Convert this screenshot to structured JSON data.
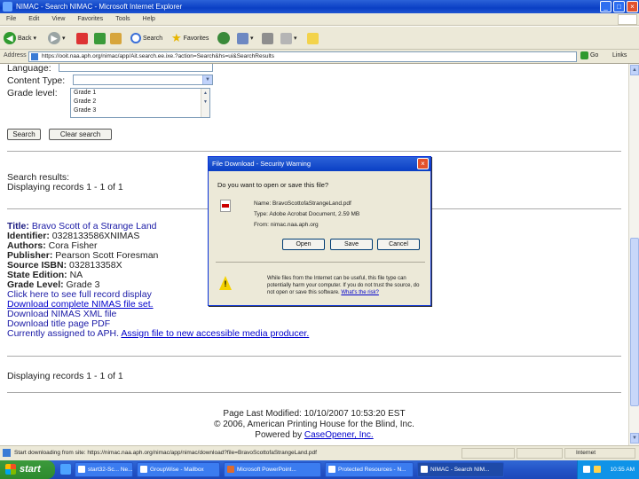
{
  "window": {
    "title": "NIMAC - Search NIMAC - Microsoft Internet Explorer"
  },
  "menu": [
    "File",
    "Edit",
    "View",
    "Favorites",
    "Tools",
    "Help"
  ],
  "toolbar": {
    "back": "Back",
    "search": "Search",
    "favorites": "Favorites"
  },
  "address": {
    "label": "Address",
    "url": "https://ooit.naa.aph.org/nimac/app/Ait.search.ee.ixe.?action=Search&hs=ui&SearchResults",
    "go": "Go",
    "links": "Links"
  },
  "form": {
    "language_label": "Language:",
    "content_type_label": "Content Type:",
    "grade_level_label": "Grade level:",
    "grades": [
      "Grade 1",
      "Grade 2",
      "Grade 3"
    ],
    "search_button": "Search",
    "clear_button": "Clear search"
  },
  "results": {
    "heading": "Search results:",
    "displaying": "Displaying records 1 - 1 of 1",
    "title_label": "Title:",
    "title_value": "Bravo Scott of a Strange Land",
    "identifier_label": "Identifier:",
    "identifier_value": "0328133586XNIMAS",
    "authors_label": "Authors:",
    "authors_value": "Cora Fisher",
    "publisher_label": "Publisher:",
    "publisher_value": "Pearson Scott Foresman",
    "isbn_label": "Source ISBN:",
    "isbn_value": "032813358X",
    "state_label": "State Edition:",
    "state_value": "NA",
    "grade_label": "Grade Level:",
    "grade_value": "Grade 3",
    "link_display": "Click here to see full record display",
    "link_zip": "Download complete NIMAS file set.",
    "link_xml": "Download NIMAS XML file",
    "link_pdf": "Download title page PDF",
    "assigned_text": "Currently assigned to APH.",
    "assigned_link": "Assign file to new accessible media producer.",
    "displaying_bottom": "Displaying records 1 - 1 of 1"
  },
  "footer": {
    "modified": "Page Last Modified: 10/10/2007 10:53:20 EST",
    "copyright": "© 2006, American Printing House for the Blind, Inc.",
    "powered": "Powered by",
    "powered_link": "CaseOpener, Inc."
  },
  "dialog": {
    "title": "File Download - Security Warning",
    "question": "Do you want to open or save this file?",
    "name_row": "Name: BravoScottofaStrangeLand.pdf",
    "type_row": "Type: Adobe Acrobat Document, 2.59 MB",
    "from_row": "From: nimac.naa.aph.org",
    "open": "Open",
    "save": "Save",
    "cancel": "Cancel",
    "warning": "While files from the Internet can be useful, this file type can potentially harm your computer. If you do not trust the source, do not open or save this software.",
    "warning_link": "What's the risk?"
  },
  "status": {
    "text": "Start downloading from site: https://nimac.naa.aph.org/nimac/app/nimac/download?file=BravoScottofaStrangeLand.pdf",
    "zone": "Internet"
  },
  "taskbar": {
    "start": "start",
    "tasks": [
      "start32-Sc... Ne...",
      "GroupWise - Mailbox",
      "Microsoft PowerPoint...",
      "Protected Resources - N...",
      "NIMAC - Search NIM..."
    ],
    "clock": "10:55 AM"
  },
  "colors": {
    "title_blue": "#0a3fc4",
    "result_title": "#1a1aa6",
    "link": "#0000cc",
    "start_green": "#2d8a2d"
  }
}
